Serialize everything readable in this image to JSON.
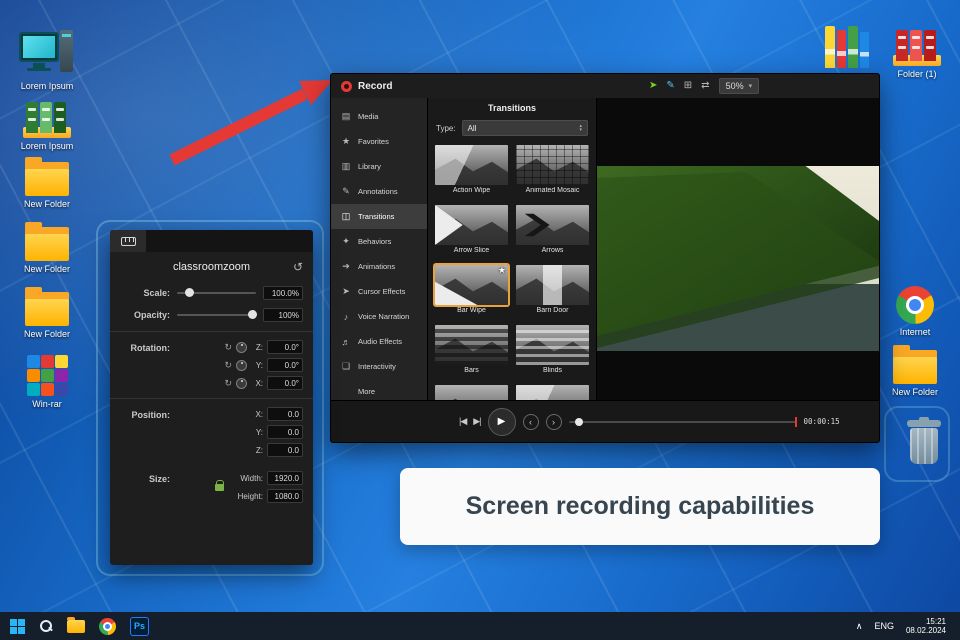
{
  "colors": {
    "accent_red": "#e53935",
    "selection_yellow": "#e8a33d",
    "taskbar": "#141f2b"
  },
  "icons": {
    "caret_up": "∧",
    "caret_down": "▾",
    "play": "▶",
    "step_back": "|◀",
    "step_forward": "▶|",
    "prev": "‹",
    "next": "›",
    "reset": "↺",
    "star": "★",
    "cursor": "➤",
    "pen": "✎",
    "crop": "⊞",
    "expand": "⇄",
    "spin_up": "▴",
    "spin_down": "▾",
    "rotate": "↻",
    "ps": "Ps"
  },
  "desktop": {
    "left_icons": [
      {
        "name": "computer",
        "label": "Lorem Ipsum"
      },
      {
        "name": "binders-green",
        "label": "Lorem Ipsum"
      },
      {
        "name": "folder",
        "label": "New Folder"
      },
      {
        "name": "folder",
        "label": "New Folder"
      },
      {
        "name": "folder",
        "label": "New Folder"
      },
      {
        "name": "winrar",
        "label": "Win-rar"
      }
    ],
    "right_icons": [
      {
        "name": "library",
        "label": ""
      },
      {
        "name": "binders-red",
        "label": "Folder (1)"
      },
      {
        "name": "chrome",
        "label": "Internet"
      },
      {
        "name": "folder",
        "label": "New Folder"
      },
      {
        "name": "recycle-bin",
        "label": ""
      }
    ]
  },
  "recorder": {
    "record_label": "Record",
    "zoom_value": "50%",
    "sidebar": [
      {
        "icon": "▤",
        "label": "Media"
      },
      {
        "icon": "★",
        "label": "Favorites"
      },
      {
        "icon": "▥",
        "label": "Library"
      },
      {
        "icon": "✎",
        "label": "Annotations"
      },
      {
        "icon": "◫",
        "label": "Transitions"
      },
      {
        "icon": "✦",
        "label": "Behaviors"
      },
      {
        "icon": "➔",
        "label": "Animations"
      },
      {
        "icon": "➤",
        "label": "Cursor Effects"
      },
      {
        "icon": "♪",
        "label": "Voice Narration"
      },
      {
        "icon": "♬",
        "label": "Audio Effects"
      },
      {
        "icon": "❏",
        "label": "Interactivity"
      },
      {
        "icon": "",
        "label": "More"
      }
    ],
    "panel": {
      "title": "Transitions",
      "type_label": "Type:",
      "type_value": "All",
      "transitions": [
        {
          "label": "Action Wipe"
        },
        {
          "label": "Animated Mosaic"
        },
        {
          "label": "Arrow Slice"
        },
        {
          "label": "Arrows"
        },
        {
          "label": "Bar Wipe",
          "selected": true
        },
        {
          "label": "Barn Door"
        },
        {
          "label": "Bars"
        },
        {
          "label": "Blinds"
        }
      ]
    },
    "player": {
      "timestamp": "00:00:15"
    }
  },
  "properties": {
    "title": "classroomzoom",
    "scale_label": "Scale:",
    "scale_value": "100.0%",
    "opacity_label": "Opacity:",
    "opacity_value": "100%",
    "rotation_label": "Rotation:",
    "rotation": [
      {
        "axis": "Z:",
        "value": "0.0°"
      },
      {
        "axis": "Y:",
        "value": "0.0°"
      },
      {
        "axis": "X:",
        "value": "0.0°"
      }
    ],
    "position_label": "Position:",
    "position": [
      {
        "axis": "X:",
        "value": "0.0"
      },
      {
        "axis": "Y:",
        "value": "0.0"
      },
      {
        "axis": "Z:",
        "value": "0.0"
      }
    ],
    "size_label": "Size:",
    "size": [
      {
        "axis": "Width:",
        "value": "1920.0"
      },
      {
        "axis": "Height:",
        "value": "1080.0"
      }
    ]
  },
  "banner": {
    "text": "Screen recording capabilities"
  },
  "taskbar": {
    "lang": "ENG",
    "time": "15:21",
    "date": "08.02.2024"
  }
}
